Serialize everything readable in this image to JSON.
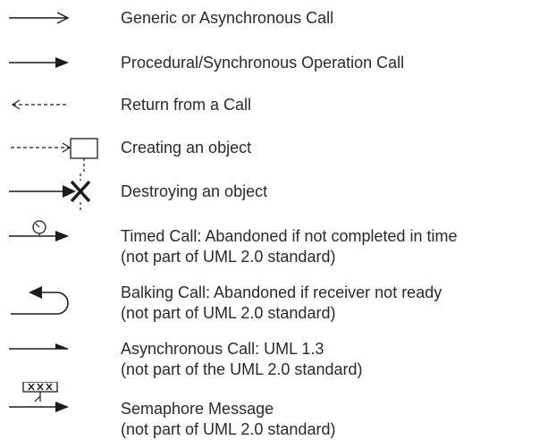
{
  "legend": {
    "items": [
      {
        "id": "generic",
        "lines": [
          "Generic or Asynchronous Call"
        ]
      },
      {
        "id": "procedural",
        "lines": [
          "Procedural/Synchronous Operation Call"
        ]
      },
      {
        "id": "return",
        "lines": [
          "Return from a Call"
        ]
      },
      {
        "id": "create",
        "lines": [
          "Creating an object"
        ]
      },
      {
        "id": "destroy",
        "lines": [
          "Destroying an object"
        ]
      },
      {
        "id": "timed",
        "lines": [
          "Timed Call: Abandoned if not completed in time",
          "(not part of UML 2.0 standard)"
        ]
      },
      {
        "id": "balking",
        "lines": [
          "Balking Call: Abandoned if receiver not ready",
          "(not part of UML 2.0 standard)"
        ]
      },
      {
        "id": "async13",
        "lines": [
          "Asynchronous Call: UML 1.3",
          "(not part of the UML 2.0 standard)"
        ]
      },
      {
        "id": "semaphore",
        "lines": [
          "Semaphore Message",
          "(not part of UML 2.0 standard)"
        ]
      }
    ],
    "colors": {
      "stroke": "#1c1c1c",
      "text": "#2a2a2a"
    }
  }
}
